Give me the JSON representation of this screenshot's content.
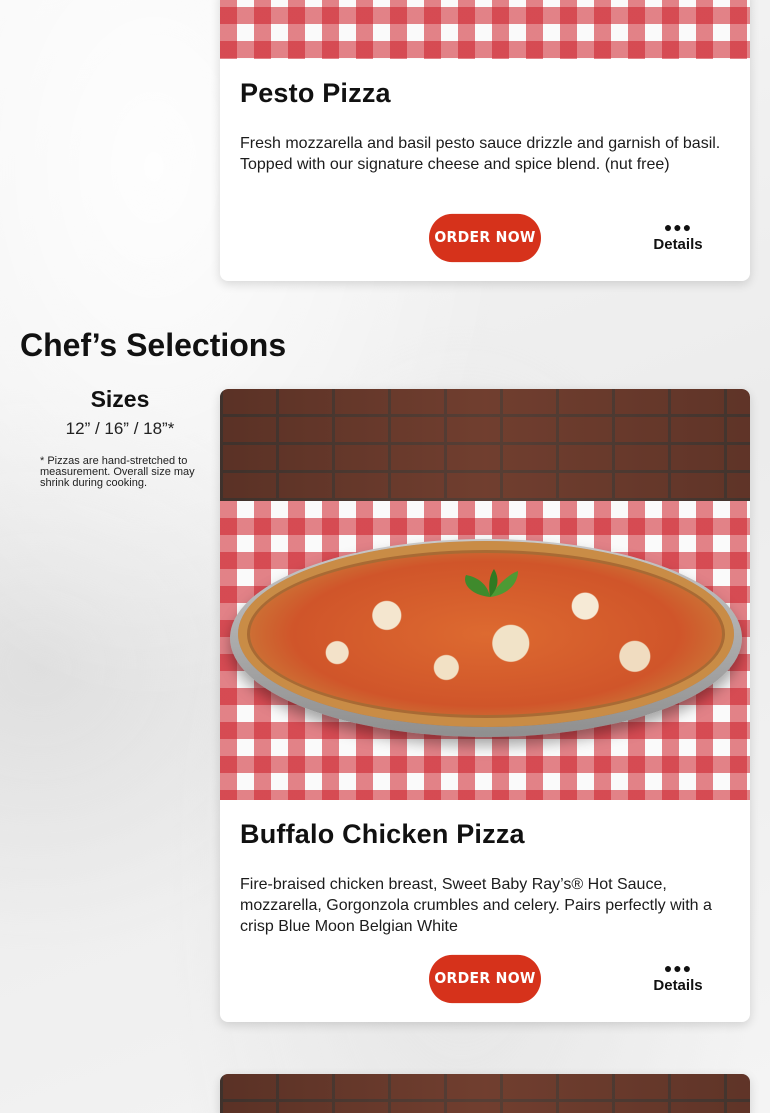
{
  "cards": [
    {
      "title": "Pesto Pizza",
      "description": "Fresh mozzarella and basil pesto sauce drizzle and garnish of basil. Topped with our signature cheese and spice blend. (nut free)",
      "order_label": "ORDER NOW",
      "details_icon": "more-dots-icon",
      "details_label": "Details"
    },
    {
      "title": "Buffalo Chicken Pizza",
      "description": "Fire-braised chicken breast, Sweet Baby Ray’s® Hot Sauce, mozzarella, Gorgonzola crumbles and celery. Pairs perfectly with a crisp Blue Moon Belgian White",
      "order_label": "ORDER NOW",
      "details_icon": "more-dots-icon",
      "details_label": "Details"
    }
  ],
  "section": {
    "title": "Chef’s Selections"
  },
  "sizes": {
    "heading": "Sizes",
    "values": "12” / 16” / 18”*",
    "note": "* Pizzas are hand-stretched to measurement. Overall size may shrink during cooking."
  },
  "colors": {
    "order_button": "#d6321b",
    "tablecloth_red": "#cd1e28"
  }
}
